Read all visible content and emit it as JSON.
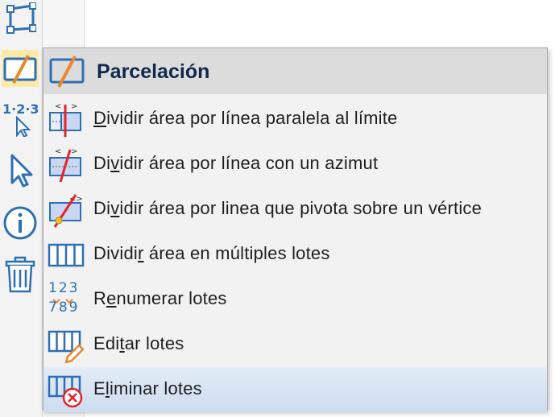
{
  "menu": {
    "title": "Parcelación",
    "items": [
      {
        "pre": "",
        "acc": "D",
        "post": "ividir área por línea paralela al límite",
        "icon": "divide-parallel-icon"
      },
      {
        "pre": "Di",
        "acc": "v",
        "post": "idir área por línea con un azimut",
        "icon": "divide-azimuth-icon"
      },
      {
        "pre": "Di",
        "acc": "v",
        "post": "idir área por linea que pivota sobre un vértice",
        "icon": "divide-pivot-icon"
      },
      {
        "pre": "Dividi",
        "acc": "r",
        "post": " área en múltiples lotes",
        "icon": "multiple-lots-icon"
      },
      {
        "pre": "R",
        "acc": "e",
        "post": "numerar lotes",
        "icon": "renumber-icon"
      },
      {
        "pre": "Edi",
        "acc": "t",
        "post": "ar lotes",
        "icon": "edit-lots-icon"
      },
      {
        "pre": "E",
        "acc": "l",
        "post": "iminar lotes",
        "icon": "delete-lots-icon"
      }
    ]
  },
  "toolbar": {
    "tools": [
      "polygon-icon",
      "parcel-icon",
      "renumber-select-icon",
      "pointer-icon",
      "info-icon",
      "trash-icon"
    ],
    "renumber_text": "1·2·3"
  },
  "renumber_icon": {
    "top": "123",
    "bottom": "789"
  },
  "colors": {
    "accent": "#2e6eb5",
    "orange": "#e8872c",
    "red": "#e8202a",
    "highlight": "#d6e3f3"
  }
}
